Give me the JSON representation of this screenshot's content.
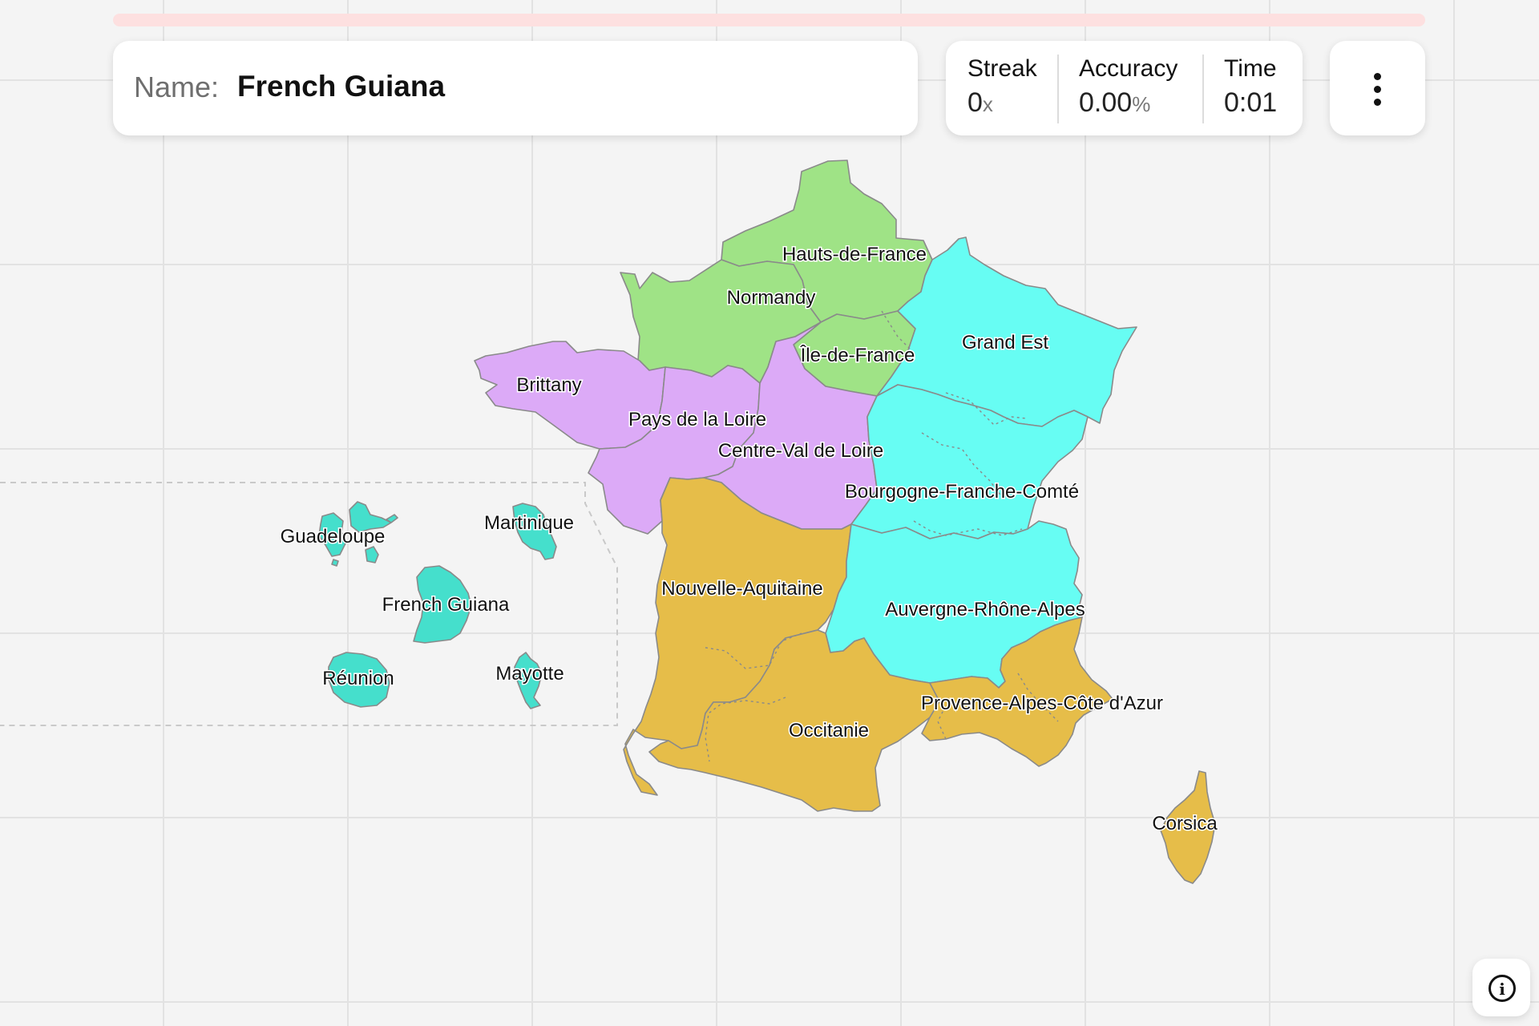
{
  "game": {
    "prompt_label": "Name:",
    "target": "French Guiana",
    "progress_fraction": 0
  },
  "stats": {
    "streak": {
      "label": "Streak",
      "value": "0",
      "unit": "x"
    },
    "accuracy": {
      "label": "Accuracy",
      "value": "0.00",
      "unit": "%"
    },
    "time": {
      "label": "Time",
      "value": "0:01"
    }
  },
  "menu": {
    "icon": "vertical-dots-icon"
  },
  "info": {
    "icon": "info-icon",
    "glyph": "i"
  },
  "map": {
    "colors": {
      "green": "#9fe386",
      "purple": "#dcaaf7",
      "cyan": "#67fdf3",
      "gold": "#e6bd49",
      "teal": "#45dfcc"
    },
    "regions": [
      {
        "id": "hauts-de-france",
        "label": "Hauts-de-France",
        "color": "green"
      },
      {
        "id": "normandy",
        "label": "Normandy",
        "color": "green"
      },
      {
        "id": "ile-de-france",
        "label": "Île-de-France",
        "color": "green"
      },
      {
        "id": "grand-est",
        "label": "Grand Est",
        "color": "cyan"
      },
      {
        "id": "brittany",
        "label": "Brittany",
        "color": "purple"
      },
      {
        "id": "pays-de-la-loire",
        "label": "Pays de la Loire",
        "color": "purple"
      },
      {
        "id": "centre-val-de-loire",
        "label": "Centre-Val de Loire",
        "color": "purple"
      },
      {
        "id": "bourgogne-franche-comte",
        "label": "Bourgogne-Franche-Comté",
        "color": "cyan"
      },
      {
        "id": "nouvelle-aquitaine",
        "label": "Nouvelle-Aquitaine",
        "color": "gold"
      },
      {
        "id": "auvergne-rhone-alpes",
        "label": "Auvergne-Rhône-Alpes",
        "color": "cyan"
      },
      {
        "id": "occitanie",
        "label": "Occitanie",
        "color": "gold"
      },
      {
        "id": "provence-alpes-cote-d-azur",
        "label": "Provence-Alpes-Côte d'Azur",
        "color": "gold"
      },
      {
        "id": "corsica",
        "label": "Corsica",
        "color": "gold"
      },
      {
        "id": "guadeloupe",
        "label": "Guadeloupe",
        "color": "teal"
      },
      {
        "id": "martinique",
        "label": "Martinique",
        "color": "teal"
      },
      {
        "id": "french-guiana",
        "label": "French Guiana",
        "color": "teal"
      },
      {
        "id": "reunion",
        "label": "Réunion",
        "color": "teal"
      },
      {
        "id": "mayotte",
        "label": "Mayotte",
        "color": "teal"
      }
    ]
  }
}
